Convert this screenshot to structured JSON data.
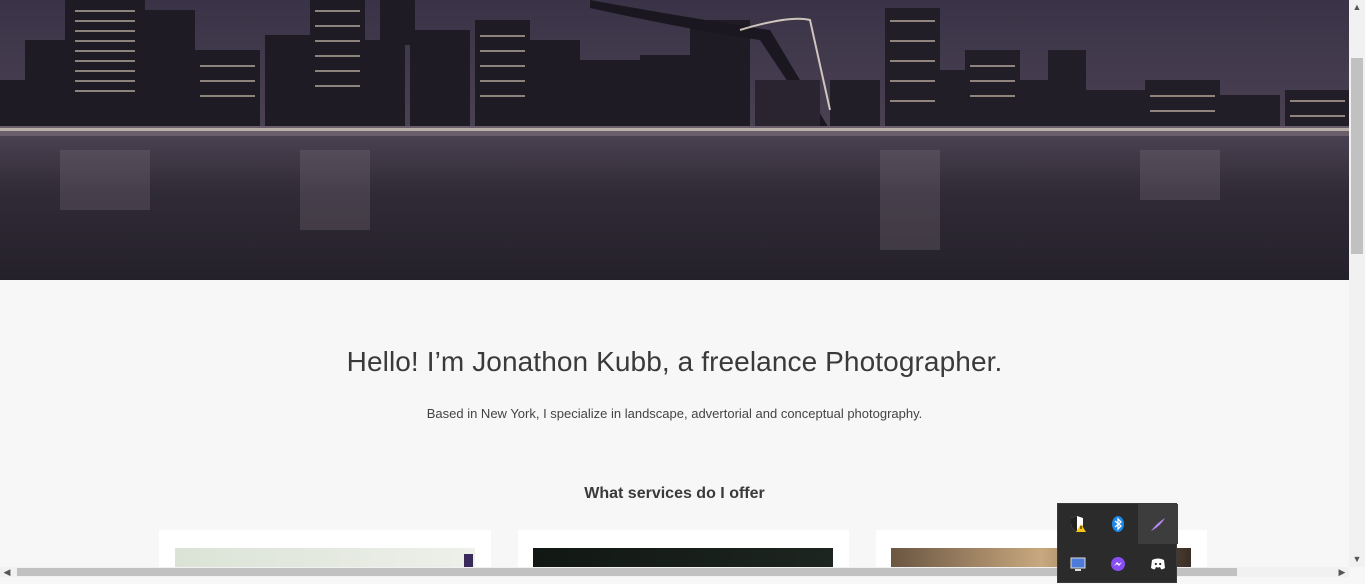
{
  "hero": {
    "image_alt": "city skyline with bridge at night"
  },
  "intro": {
    "headline": "Hello! I’m Jonathon Kubb, a freelance Photographer.",
    "subline": "Based in New York, I specialize in landscape, advertorial and conceptual photography."
  },
  "services": {
    "heading": "What services do I offer"
  },
  "tray": {
    "icons": [
      "security-warning-icon",
      "bluetooth-icon",
      "pen-feather-icon",
      "display-icon",
      "messenger-icon",
      "discord-icon"
    ]
  },
  "colors": {
    "background": "#f7f7f7",
    "text": "#3a3a3a",
    "tray_bg": "#2b2b2b"
  }
}
